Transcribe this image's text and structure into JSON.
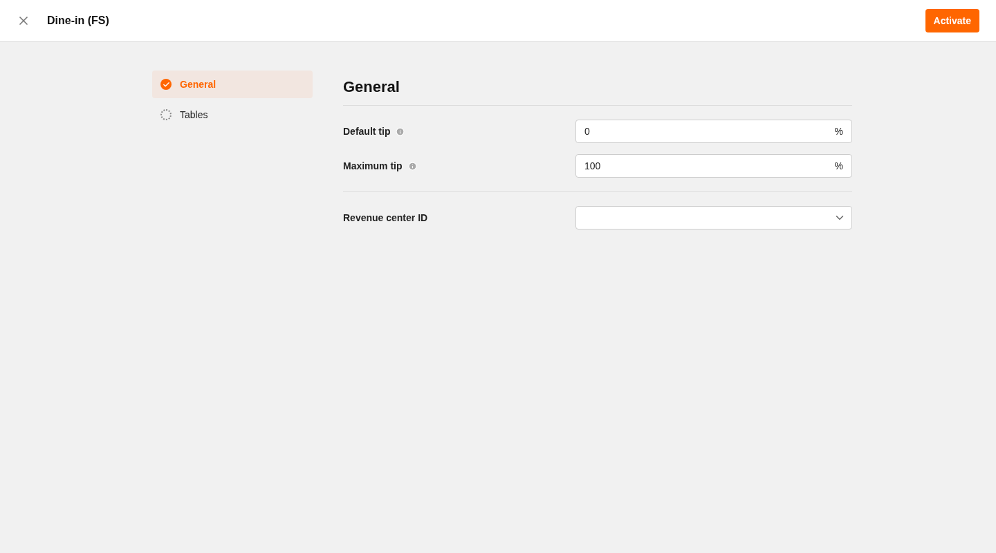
{
  "header": {
    "title": "Dine-in (FS)",
    "action": "Activate"
  },
  "nav": [
    {
      "label": "General",
      "selected": true,
      "kind": "done"
    },
    {
      "label": "Tables",
      "selected": false,
      "kind": "pending"
    }
  ],
  "section": {
    "title": "General"
  },
  "groups": [
    [
      {
        "kind": "number",
        "label": "Default tip",
        "info": true,
        "value": "0",
        "suffix": "%"
      },
      {
        "kind": "number",
        "label": "Maximum tip",
        "info": true,
        "value": "100",
        "suffix": "%"
      }
    ],
    [
      {
        "kind": "select",
        "label": "Revenue center ID",
        "info": false
      }
    ]
  ]
}
